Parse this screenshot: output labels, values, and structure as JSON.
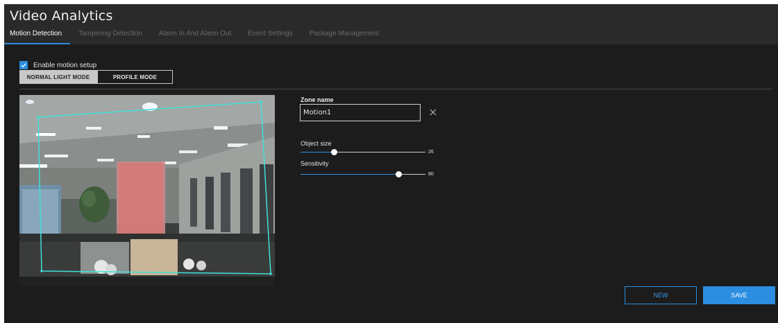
{
  "window": {
    "title": "Video Analytics"
  },
  "tabs": [
    {
      "label": "Motion Detection",
      "active": true
    },
    {
      "label": "Tampering Detection",
      "active": false
    },
    {
      "label": "Alarm In And Alarm Out",
      "active": false
    },
    {
      "label": "Event Settings",
      "active": false
    },
    {
      "label": "Package Management",
      "active": false
    }
  ],
  "motion": {
    "enable_label": "Enable motion setup",
    "enabled": true,
    "modes": {
      "normal": "NORMAL LIGHT MODE",
      "profile": "PROFILE MODE",
      "selected": "normal"
    }
  },
  "zone": {
    "name_label": "Zone name",
    "name_value": "Motion1"
  },
  "object_size": {
    "label": "Object size",
    "value": "26",
    "fraction": 0.26
  },
  "sensitivity": {
    "label": "Sensitivity",
    "value": "80",
    "fraction": 0.8
  },
  "actions": {
    "new_label": "NEW",
    "save_label": "SAVE"
  },
  "colors": {
    "accent": "#2b8ee0",
    "zone_outline": "#3fe0d8",
    "motion_highlight": "#e07070"
  },
  "icons": {
    "checkbox": "check-icon",
    "clear": "close-icon"
  }
}
